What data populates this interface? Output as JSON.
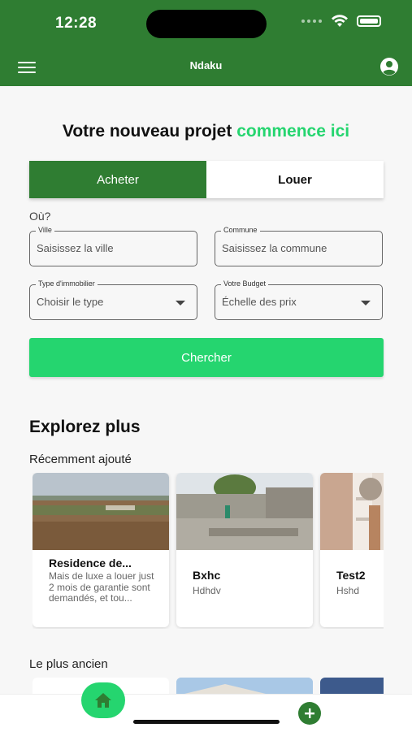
{
  "status": {
    "time": "12:28"
  },
  "appbar": {
    "title": "Ndaku"
  },
  "hero": {
    "headline_main": "Votre nouveau projet",
    "headline_accent": "commence ici"
  },
  "toggle": {
    "buy": "Acheter",
    "rent": "Louer",
    "active": "buy"
  },
  "search": {
    "where_label": "Où?",
    "city": {
      "label": "Ville",
      "placeholder": "Saisissez la ville"
    },
    "commune": {
      "label": "Commune",
      "placeholder": "Saisissez la commune"
    },
    "type": {
      "label": "Type d'immobilier",
      "value": "Choisir le type"
    },
    "budget": {
      "label": "Votre Budget",
      "value": "Échelle des prix"
    },
    "button": "Chercher"
  },
  "explore": {
    "title": "Explorez plus",
    "recent_title": "Récemment ajouté",
    "recent": [
      {
        "title": "Residence de...",
        "desc": "Mais de luxe a louer just 2 mois de garantie sont demandés, et tou..."
      },
      {
        "title": "Bxhc",
        "desc": "Hdhdv"
      },
      {
        "title": "Test2",
        "desc": "Hshd"
      }
    ],
    "oldest_title": "Le plus ancien"
  },
  "colors": {
    "primary": "#2f7d32",
    "accent": "#25d56f"
  },
  "icons": {
    "menu": "menu-icon",
    "account": "account-circle-icon",
    "home": "home-icon",
    "add": "add-circle-icon"
  }
}
